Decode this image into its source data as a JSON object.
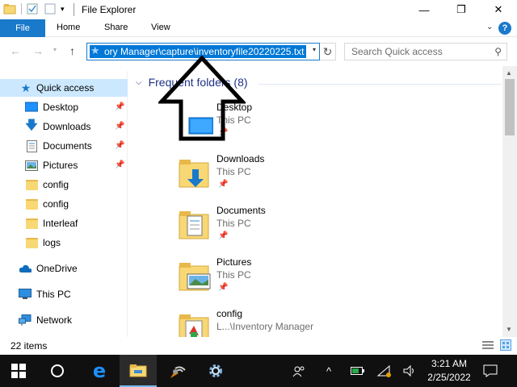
{
  "window": {
    "title": "File Explorer",
    "minimize": "—",
    "maximize": "❐",
    "close": "✕"
  },
  "ribbon": {
    "tabs": [
      "File",
      "Home",
      "Share",
      "View"
    ],
    "help": "?"
  },
  "address_bar": {
    "path": "ory Manager\\capture\\inventoryfile20220225.txt"
  },
  "search": {
    "placeholder": "Search Quick access"
  },
  "sidebar": {
    "items": [
      {
        "label": "Quick access",
        "icon": "star-icon",
        "selected": true
      },
      {
        "label": "Desktop",
        "icon": "desktop-icon",
        "pinned": true
      },
      {
        "label": "Downloads",
        "icon": "download-arrow-icon",
        "pinned": true
      },
      {
        "label": "Documents",
        "icon": "documents-icon",
        "pinned": true
      },
      {
        "label": "Pictures",
        "icon": "pictures-icon",
        "pinned": true
      },
      {
        "label": "config",
        "icon": "folder-icon"
      },
      {
        "label": "config",
        "icon": "folder-icon"
      },
      {
        "label": "Interleaf",
        "icon": "folder-icon"
      },
      {
        "label": "logs",
        "icon": "folder-icon"
      },
      {
        "label": "OneDrive",
        "icon": "cloud-icon"
      },
      {
        "label": "This PC",
        "icon": "computer-icon"
      },
      {
        "label": "Network",
        "icon": "network-icon"
      }
    ]
  },
  "main": {
    "group_title": "Frequent folders (8)",
    "tiles": [
      {
        "name": "Desktop",
        "location": "This PC",
        "icon": "desktop-icon"
      },
      {
        "name": "Downloads",
        "location": "This PC",
        "icon": "download-folder-icon"
      },
      {
        "name": "Documents",
        "location": "This PC",
        "icon": "documents-folder-icon"
      },
      {
        "name": "Pictures",
        "location": "This PC",
        "icon": "pictures-folder-icon"
      },
      {
        "name": "config",
        "location": "L...\\Inventory Manager",
        "icon": "config-folder-icon"
      }
    ]
  },
  "status": {
    "item_count": "22 items"
  },
  "taskbar": {
    "time": "3:21 AM",
    "date": "2/25/2022"
  },
  "colors": {
    "accent": "#1979ca",
    "selection": "#0078d7",
    "sidebar_selected": "#cce8ff",
    "taskbar": "#101010",
    "folder": "#f8d775"
  }
}
